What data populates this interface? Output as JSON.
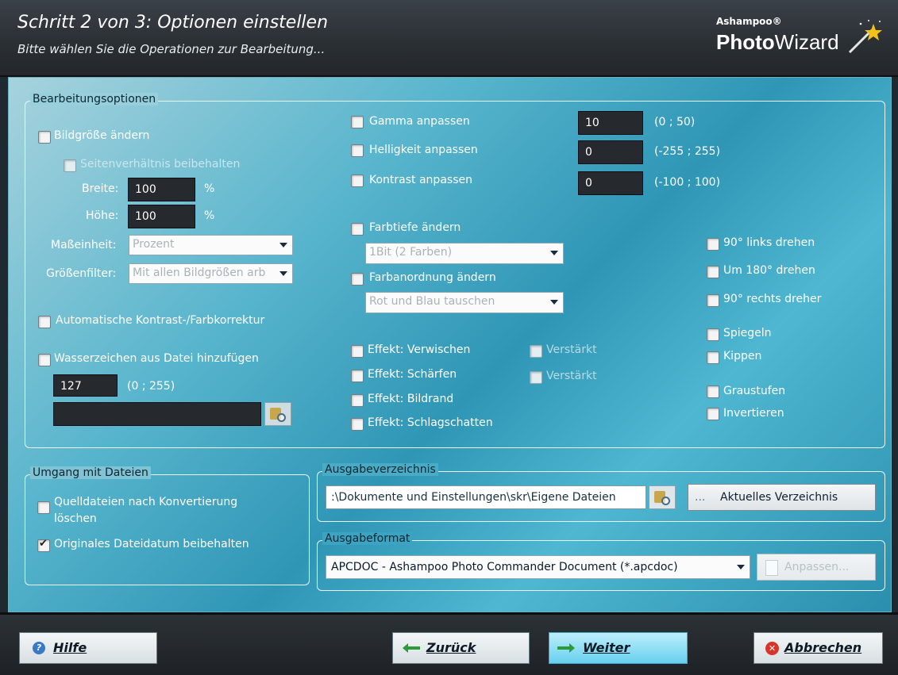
{
  "header": {
    "title": "Schritt 2 von 3: Optionen einstellen",
    "subtitle": "Bitte wählen Sie die Operationen zur Bearbeitung...",
    "logo_small": "Ashampoo®",
    "logo_photo": "Photo",
    "logo_wizard": "Wizard"
  },
  "edit_options": {
    "legend": "Bearbeitungsoptionen",
    "resize": {
      "label": "Bildgröße ändern",
      "keep_ratio": "Seitenverhältnis beibehalten",
      "width_label": "Breite:",
      "width_value": "100",
      "width_unit": "%",
      "height_label": "Höhe:",
      "height_value": "100",
      "height_unit": "%",
      "unit_label": "Maßeinheit:",
      "unit_value": "Prozent",
      "filter_label": "Größenfilter:",
      "filter_value": "Mit allen Bildgrößen arb"
    },
    "auto_correct": "Automatische Kontrast-/Farbkorrektur",
    "watermark": {
      "label": "Wasserzeichen aus Datei hinzufügen",
      "value": "127",
      "range": "(0 ; 255)",
      "file": ""
    },
    "gamma": {
      "label": "Gamma anpassen",
      "value": "10",
      "range": "(0 ; 50)"
    },
    "brightness": {
      "label": "Helligkeit anpassen",
      "value": "0",
      "range": "(-255 ; 255)"
    },
    "contrast": {
      "label": "Kontrast anpassen",
      "value": "0",
      "range": "(-100 ; 100)"
    },
    "color_depth": {
      "label": "Farbtiefe ändern",
      "value": "1Bit (2 Farben)"
    },
    "color_order": {
      "label": "Farbanordnung ändern",
      "value": "Rot und Blau tauschen"
    },
    "effects": {
      "blur": "Effekt: Verwischen",
      "blur_strong": "Verstärkt",
      "sharpen": "Effekt: Schärfen",
      "sharpen_strong": "Verstärkt",
      "frame": "Effekt: Bildrand",
      "shadow": "Effekt: Schlagschatten"
    },
    "rotate": {
      "left": "90° links drehen",
      "r180": "Um 180° drehen",
      "right": "90° rechts dreher",
      "mirror": "Spiegeln",
      "flip": "Kippen",
      "gray": "Graustufen",
      "invert": "Invertieren"
    }
  },
  "files": {
    "legend": "Umgang mit Dateien",
    "delete_source_line1": "Quelldateien nach Konvertierung",
    "delete_source_line2": "löschen",
    "keep_date": "Originales Dateidatum beibehalten",
    "keep_date_checked": true
  },
  "output_dir": {
    "legend": "Ausgabeverzeichnis",
    "path": ":\\Dokumente und Einstellungen\\skr\\Eigene Dateien",
    "current_button": "Aktuelles Verzeichnis",
    "current_button_prefix": "..."
  },
  "output_format": {
    "legend": "Ausgabeformat",
    "value": "APCDOC - Ashampoo Photo Commander Document (*.apcdoc)",
    "customize_button": "Anpassen..."
  },
  "footer": {
    "help": "Hilfe",
    "back": "Zurück",
    "next": "Weiter",
    "cancel": "Abbrechen"
  },
  "colors": {
    "accent": "#4fb7d1",
    "header": "#2b3035",
    "primary_button": "#67d0ef"
  }
}
